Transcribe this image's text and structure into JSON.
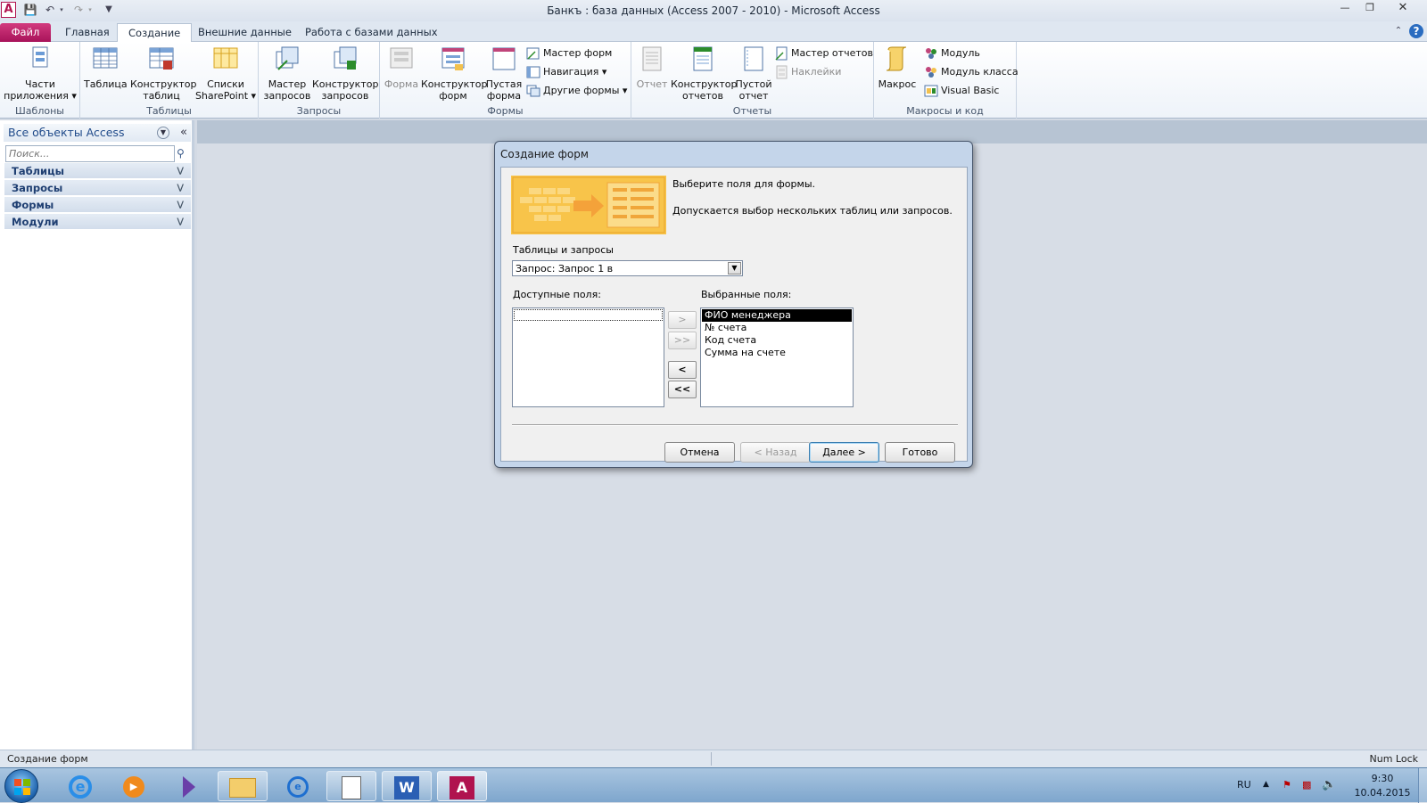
{
  "window": {
    "title": "Банкъ : база данных (Access 2007 - 2010)  -  Microsoft Access",
    "app_icon": "access-icon"
  },
  "tabs": [
    {
      "label": "Файл"
    },
    {
      "label": "Главная"
    },
    {
      "label": "Создание"
    },
    {
      "label": "Внешние данные"
    },
    {
      "label": "Работа с базами данных"
    }
  ],
  "ribbon": {
    "groups": {
      "templates": "Шаблоны",
      "tables": "Таблицы",
      "queries": "Запросы",
      "forms": "Формы",
      "reports": "Отчеты",
      "macros": "Макросы и код"
    },
    "app_parts": [
      "Части",
      "приложения ▾"
    ],
    "table": "Таблица",
    "table_designer": [
      "Конструктор",
      "таблиц"
    ],
    "sharepoint_lists": [
      "Списки",
      "SharePoint ▾"
    ],
    "query_wizard": [
      "Мастер",
      "запросов"
    ],
    "query_designer": [
      "Конструктор",
      "запросов"
    ],
    "form": "Форма",
    "form_designer": [
      "Конструктор",
      "форм"
    ],
    "blank_form": [
      "Пустая",
      "форма"
    ],
    "form_wizard": "Мастер форм",
    "navigation": "Навигация ▾",
    "other_forms": "Другие формы ▾",
    "report": "Отчет",
    "report_designer": [
      "Конструктор",
      "отчетов"
    ],
    "blank_report": [
      "Пустой",
      "отчет"
    ],
    "report_wizard": "Мастер отчетов",
    "labels": "Наклейки",
    "macro": "Макрос",
    "module": "Модуль",
    "class_module": "Модуль класса",
    "visual_basic": "Visual Basic"
  },
  "nav": {
    "header": "Все объекты Access",
    "search_placeholder": "Поиск...",
    "categories": [
      "Таблицы",
      "Запросы",
      "Формы",
      "Модули"
    ]
  },
  "dialog": {
    "title": "Создание форм",
    "heading": "Выберите поля для формы.",
    "subheading": "Допускается выбор нескольких таблиц или запросов.",
    "tables_label": "Таблицы и запросы",
    "tables_value": "Запрос: Запрос 1 в",
    "available_label": "Доступные поля:",
    "selected_label": "Выбранные поля:",
    "available_fields": [],
    "selected_fields": [
      "ФИО менеджера",
      "№ счета",
      "Код счета",
      "Сумма на счете"
    ],
    "move_buttons": [
      ">",
      ">>",
      "<",
      "<<"
    ],
    "buttons": {
      "cancel": "Отмена",
      "back": "< Назад",
      "next": "Далее >",
      "finish": "Готово"
    }
  },
  "status": {
    "left": "Создание форм",
    "right": "Num Lock"
  },
  "tray": {
    "lang": "RU",
    "time": "9:30",
    "date": "10.04.2015"
  }
}
